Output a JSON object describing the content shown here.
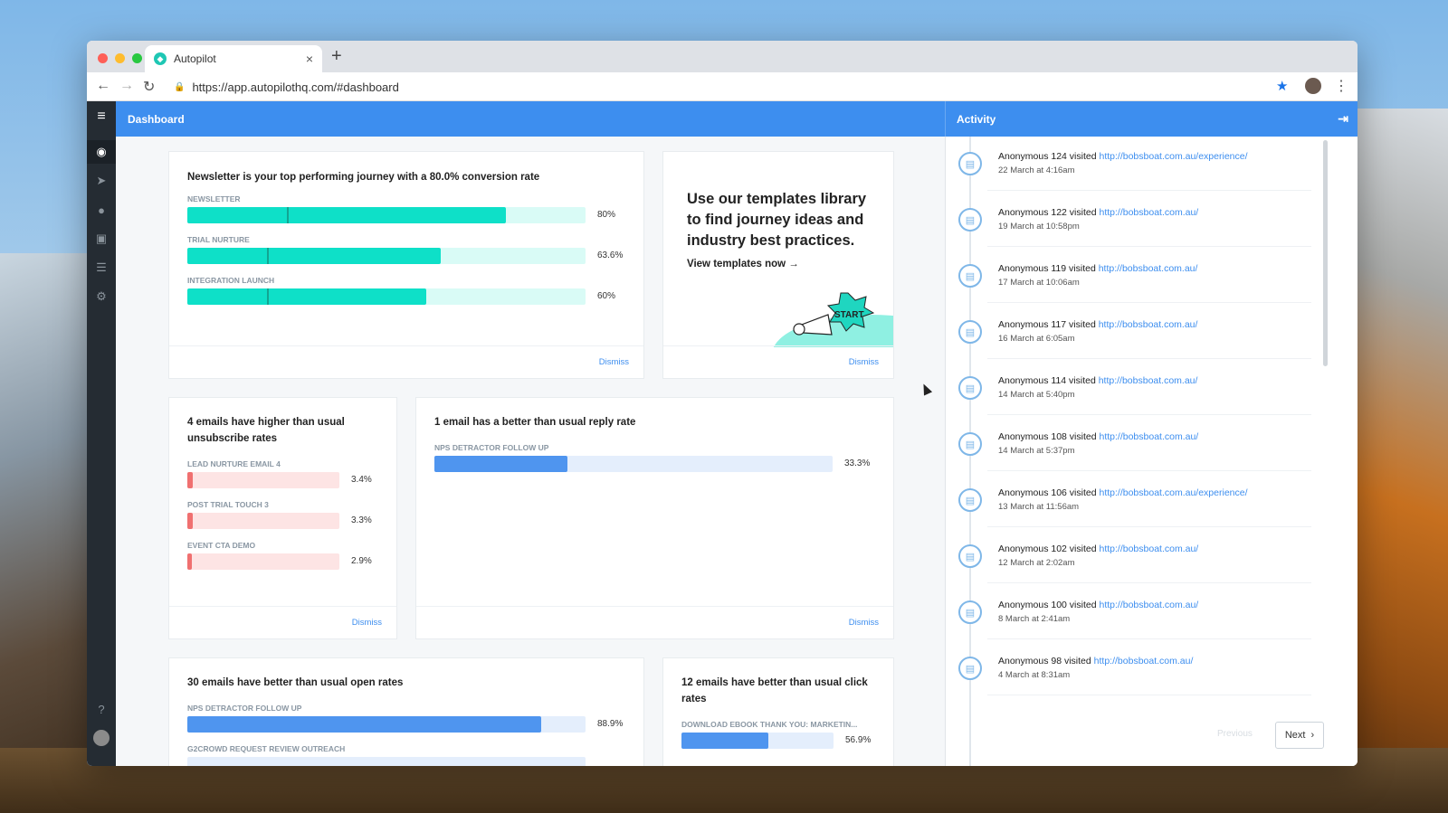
{
  "browser": {
    "tab_title": "Autopilot",
    "url": "https://app.autopilothq.com/#dashboard",
    "new_tab_label": "+",
    "tab_close": "×"
  },
  "header": {
    "dashboard_title": "Dashboard",
    "activity_title": "Activity"
  },
  "journey_card": {
    "title": "Newsletter is your top performing journey with a 80.0% conversion rate",
    "bars": [
      {
        "label": "NEWSLETTER",
        "value": 80,
        "pct": "80%"
      },
      {
        "label": "TRIAL NURTURE",
        "value": 63.6,
        "pct": "63.6%"
      },
      {
        "label": "INTEGRATION LAUNCH",
        "value": 60,
        "pct": "60%"
      }
    ],
    "dismiss": "Dismiss"
  },
  "promo_card": {
    "title": "Use our templates library to find journey ideas and industry best practices.",
    "link": "View templates now →",
    "sign_text": "START",
    "dismiss": "Dismiss"
  },
  "unsub_card": {
    "title": "4 emails have higher than usual unsubscribe rates",
    "bars": [
      {
        "label": "LEAD NURTURE EMAIL 4",
        "value": 3.4,
        "pct": "3.4%"
      },
      {
        "label": "POST TRIAL TOUCH 3",
        "value": 3.3,
        "pct": "3.3%"
      },
      {
        "label": "EVENT CTA DEMO",
        "value": 2.9,
        "pct": "2.9%"
      }
    ],
    "dismiss": "Dismiss"
  },
  "reply_card": {
    "title": "1 email has a better than usual reply rate",
    "bars": [
      {
        "label": "NPS DETRACTOR FOLLOW UP",
        "value": 33.3,
        "pct": "33.3%"
      }
    ],
    "dismiss": "Dismiss"
  },
  "open_card": {
    "title": "30 emails have better than usual open rates",
    "bars": [
      {
        "label": "NPS DETRACTOR FOLLOW UP",
        "value": 88.9,
        "pct": "88.9%"
      },
      {
        "label": "G2CROWD REQUEST REVIEW OUTREACH",
        "value": 0,
        "pct": ""
      }
    ]
  },
  "click_card": {
    "title": "12 emails have better than usual click rates",
    "bars": [
      {
        "label": "DOWNLOAD EBOOK THANK YOU: MARKETIN...",
        "value": 56.9,
        "pct": "56.9%"
      }
    ]
  },
  "activity": {
    "items": [
      {
        "who": "Anonymous 124 visited ",
        "link": "http://bobsboat.com.au/experience/",
        "time": "22 March at 4:16am"
      },
      {
        "who": "Anonymous 122 visited ",
        "link": "http://bobsboat.com.au/",
        "time": "19 March at 10:58pm"
      },
      {
        "who": "Anonymous 119 visited ",
        "link": "http://bobsboat.com.au/",
        "time": "17 March at 10:06am"
      },
      {
        "who": "Anonymous 117 visited ",
        "link": "http://bobsboat.com.au/",
        "time": "16 March at 6:05am"
      },
      {
        "who": "Anonymous 114 visited ",
        "link": "http://bobsboat.com.au/",
        "time": "14 March at 5:40pm"
      },
      {
        "who": "Anonymous 108 visited ",
        "link": "http://bobsboat.com.au/",
        "time": "14 March at 5:37pm"
      },
      {
        "who": "Anonymous 106 visited ",
        "link": "http://bobsboat.com.au/experience/",
        "time": "13 March at 11:56am"
      },
      {
        "who": "Anonymous 102 visited ",
        "link": "http://bobsboat.com.au/",
        "time": "12 March at 2:02am"
      },
      {
        "who": "Anonymous 100 visited ",
        "link": "http://bobsboat.com.au/",
        "time": "8 March at 2:41am"
      },
      {
        "who": "Anonymous 98 visited ",
        "link": "http://bobsboat.com.au/",
        "time": "4 March at 8:31am"
      }
    ],
    "prev_label": "Previous",
    "next_label": "Next"
  },
  "colors": {
    "accent": "#3d8eef",
    "teal_fill": "#0ee0c8",
    "teal_track": "#d9fbf6",
    "red_fill": "#f07070",
    "red_track": "#fde4e4",
    "blue_fill": "#4f95ef",
    "blue_track": "#e4eefc"
  }
}
